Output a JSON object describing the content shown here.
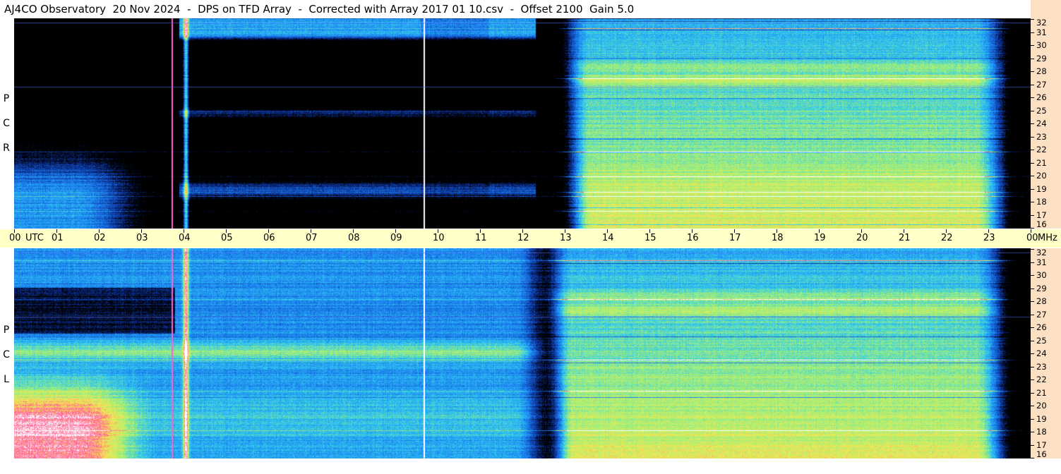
{
  "title": "AJ4CO Observatory  20 Nov 2024  -  DPS on TFD Array  -  Corrected with Array 2017 01 10.csv  -  Offset 2100  Gain 5.0",
  "chart_data": {
    "type": "heatmap",
    "title": "AJ4CO Observatory  20 Nov 2024  -  DPS on TFD Array  -  Corrected with Array 2017 01 10.csv  -  Offset 2100  Gain 5.0",
    "x_axis": {
      "unit_label": "UTC",
      "tick_labels": [
        "00",
        "01",
        "02",
        "03",
        "04",
        "05",
        "06",
        "07",
        "08",
        "09",
        "10",
        "11",
        "12",
        "13",
        "14",
        "15",
        "16",
        "17",
        "18",
        "19",
        "20",
        "21",
        "22",
        "23",
        "00"
      ],
      "range": [
        0,
        24
      ]
    },
    "y_axis": {
      "unit_label": "MHz",
      "tick_labels": [
        "16",
        "17",
        "18",
        "19",
        "20",
        "21",
        "22",
        "23",
        "24",
        "25",
        "26",
        "27",
        "28",
        "29",
        "30",
        "31",
        "32"
      ],
      "range": [
        16,
        32
      ]
    },
    "panels": [
      {
        "polarization_letters": [
          "R",
          "C",
          "P"
        ],
        "features": {
          "sun_rise_hour": 13.0,
          "sun_set_hour": 23.5
        }
      },
      {
        "polarization_letters": [
          "L",
          "C",
          "P"
        ],
        "features": {
          "sun_rise_hour": 12.6,
          "sun_set_hour": 23.5
        }
      }
    ]
  },
  "colors": {
    "background_dark": "#000000",
    "low": "#0a2a8a",
    "mid_low": "#1a7cf0",
    "mid": "#30c8f0",
    "mid_high": "#9cf07a",
    "high": "#f8e850",
    "peak": "#ff5a9a",
    "saturated": "#ffffff",
    "time_axis_bg": "#ffffc8",
    "freq_axis_bg": "#fbe0c4"
  }
}
